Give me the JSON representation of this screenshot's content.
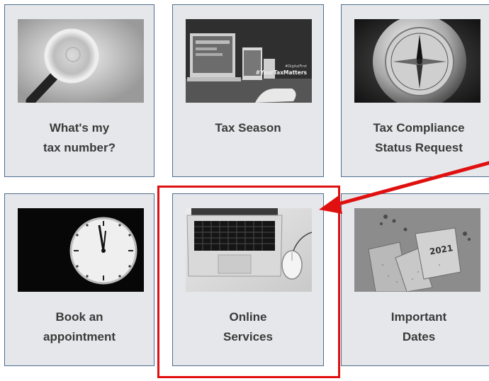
{
  "tiles": [
    {
      "line1": "What's my",
      "line2": "tax number?",
      "image_icon": "magnifying-glass"
    },
    {
      "line1": "Tax Season",
      "line2": "",
      "image_icon": "laptop-desk",
      "image_text": {
        "hashtag_small": "#DigitalFirst",
        "hashtag_large": "#YourTaxMatters"
      }
    },
    {
      "line1": "Tax Compliance",
      "line2": "Status Request",
      "image_icon": "compass"
    },
    {
      "line1": "Book an",
      "line2": "appointment",
      "image_icon": "clock"
    },
    {
      "line1": "Online",
      "line2": "Services",
      "image_icon": "laptop"
    },
    {
      "line1": "Important",
      "line2": "Dates",
      "image_icon": "notebook-2021",
      "image_text": {
        "year": "2021"
      }
    }
  ],
  "colors": {
    "tile_background": "#e6e7ea",
    "tile_border": "#4f6f8f",
    "label_text": "#3a3a3a",
    "highlight": "#e01010"
  }
}
